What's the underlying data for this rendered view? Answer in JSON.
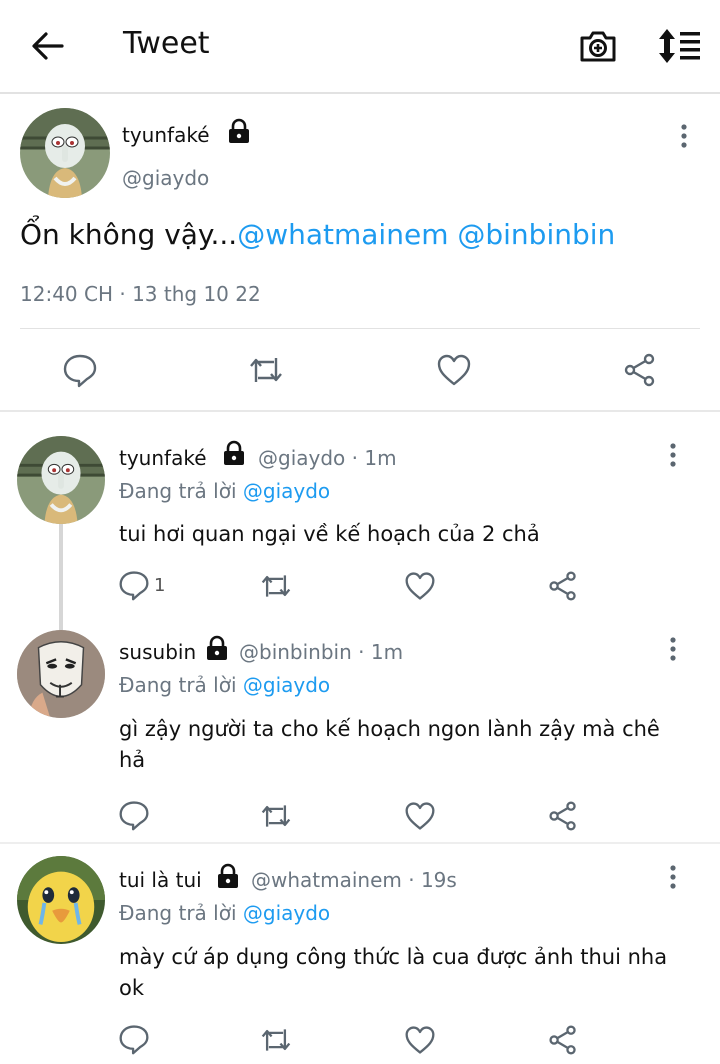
{
  "header": {
    "title": "Tweet",
    "back_icon": "arrow-left-icon",
    "camera_icon": "camera-plus-icon",
    "sort_icon": "sort-lines-icon"
  },
  "main_tweet": {
    "name": "tyunfaké",
    "handle": "@giaydo",
    "text": "Ổn không vậy...",
    "mentions": [
      "@whatmainem",
      "@binbinbin"
    ],
    "timestamp": "12:40 CH · 13 thg 10 22"
  },
  "replies": [
    {
      "name": "tyunfaké",
      "meta": "@giaydo · 1m",
      "replying_label": "Đang trả lời",
      "replying_to": "@giaydo",
      "text": "tui hơi quan ngại về kế hoạch của 2 chả",
      "reply_count": "1"
    },
    {
      "name": "susubin",
      "meta": "@binbinbin · 1m",
      "replying_label": "Đang trả lời",
      "replying_to": "@giaydo",
      "text": "gì zậy người ta cho kế hoạch ngon lành zậy mà chê hả",
      "reply_count": ""
    },
    {
      "name": "tui là tui",
      "meta": "@whatmainem · 19s",
      "replying_label": "Đang trả lời",
      "replying_to": "@giaydo",
      "text": "mày cứ áp dụng công thức là cua được ảnh thui nha ok",
      "reply_count": ""
    }
  ],
  "colors": {
    "accent": "#1d9bf0",
    "muted": "#6b7681",
    "icon": "#5b6670"
  }
}
